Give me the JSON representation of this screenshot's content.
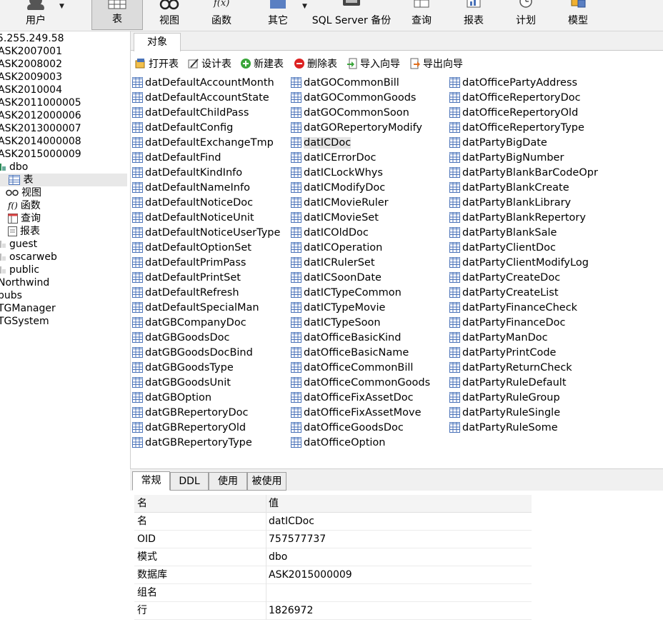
{
  "toolbar": {
    "buttons": [
      {
        "label": "用户",
        "icon": "user-icon"
      },
      {
        "label": "表",
        "icon": "table-icon"
      },
      {
        "label": "视图",
        "icon": "view-glasses-icon"
      },
      {
        "label": "函数",
        "icon": "function-icon"
      },
      {
        "label": "其它",
        "icon": "other-icon"
      },
      {
        "label": "SQL Server 备份",
        "icon": "backup-icon"
      },
      {
        "label": "查询",
        "icon": "query-icon"
      },
      {
        "label": "报表",
        "icon": "report-icon"
      },
      {
        "label": "计划",
        "icon": "schedule-icon"
      },
      {
        "label": "模型",
        "icon": "model-icon"
      }
    ]
  },
  "tree": {
    "items": [
      "5.255.249.58",
      "ASK2007001",
      "ASK2008002",
      "ASK2009003",
      "ASK2010004",
      "ASK2011000005",
      "ASK2012000006",
      "ASK2013000007",
      "ASK2014000008",
      "ASK2015000009",
      "dbo",
      "表",
      "视图",
      "函数",
      "查询",
      "报表",
      "guest",
      "oscarweb",
      "public",
      "Northwind",
      "pubs",
      "TGManager",
      "TGSystem"
    ]
  },
  "objects": {
    "tab_label": "对象",
    "actions": [
      {
        "label": "打开表",
        "icon": "open-table-icon"
      },
      {
        "label": "设计表",
        "icon": "design-table-icon"
      },
      {
        "label": "新建表",
        "icon": "new-table-icon"
      },
      {
        "label": "删除表",
        "icon": "delete-table-icon"
      },
      {
        "label": "导入向导",
        "icon": "import-wizard-icon"
      },
      {
        "label": "导出向导",
        "icon": "export-wizard-icon"
      }
    ],
    "columns": [
      [
        "datDefaultAccountMonth",
        "datDefaultAccountState",
        "datDefaultChildPass",
        "datDefaultConfig",
        "datDefaultExchangeTmp",
        "datDefaultFind",
        "datDefaultKindInfo",
        "datDefaultNameInfo",
        "datDefaultNoticeDoc",
        "datDefaultNoticeUnit",
        "datDefaultNoticeUserType",
        "datDefaultOptionSet",
        "datDefaultPrimPass",
        "datDefaultPrintSet",
        "datDefaultRefresh",
        "datDefaultSpecialMan",
        "datGBCompanyDoc",
        "datGBGoodsDoc",
        "datGBGoodsDocBind",
        "datGBGoodsType",
        "datGBGoodsUnit",
        "datGBOption",
        "datGBRepertoryDoc",
        "datGBRepertoryOld",
        "datGBRepertoryType"
      ],
      [
        "datGOCommonBill",
        "datGOCommonGoods",
        "datGOCommonSoon",
        "datGORepertoryModify",
        "datICDoc",
        "datICErrorDoc",
        "datICLockWhys",
        "datICModifyDoc",
        "datICMovieRuler",
        "datICMovieSet",
        "datICOldDoc",
        "datICOperation",
        "datICRulerSet",
        "datICSoonDate",
        "datICTypeCommon",
        "datICTypeMovie",
        "datICTypeSoon",
        "datOfficeBasicKind",
        "datOfficeBasicName",
        "datOfficeCommonBill",
        "datOfficeCommonGoods",
        "datOfficeFixAssetDoc",
        "datOfficeFixAssetMove",
        "datOfficeGoodsDoc",
        "datOfficeOption"
      ],
      [
        "datOfficePartyAddress",
        "datOfficeRepertoryDoc",
        "datOfficeRepertoryOld",
        "datOfficeRepertoryType",
        "datPartyBigDate",
        "datPartyBigNumber",
        "datPartyBlankBarCodeOpr",
        "datPartyBlankCreate",
        "datPartyBlankLibrary",
        "datPartyBlankRepertory",
        "datPartyBlankSale",
        "datPartyClientDoc",
        "datPartyClientModifyLog",
        "datPartyCreateDoc",
        "datPartyCreateList",
        "datPartyFinanceCheck",
        "datPartyFinanceDoc",
        "datPartyManDoc",
        "datPartyPrintCode",
        "datPartyReturnCheck",
        "datPartyRuleDefault",
        "datPartyRuleGroup",
        "datPartyRuleSingle",
        "datPartyRuleSome"
      ]
    ]
  },
  "info": {
    "tabs": [
      "常规",
      "DDL",
      "使用",
      "被使用"
    ],
    "header": {
      "name": "名",
      "value": "值"
    },
    "rows": [
      {
        "name": "名",
        "value": "datICDoc"
      },
      {
        "name": "OID",
        "value": "757577737"
      },
      {
        "name": "模式",
        "value": "dbo"
      },
      {
        "name": "数据库",
        "value": "ASK2015000009"
      },
      {
        "name": "组名",
        "value": ""
      },
      {
        "name": "行",
        "value": "1826972"
      }
    ]
  },
  "colors": {
    "toolbar_bg": "#f2f2f2",
    "selection_bg": "#e4e4e4",
    "table_icon_blue": "#4a72b8"
  }
}
